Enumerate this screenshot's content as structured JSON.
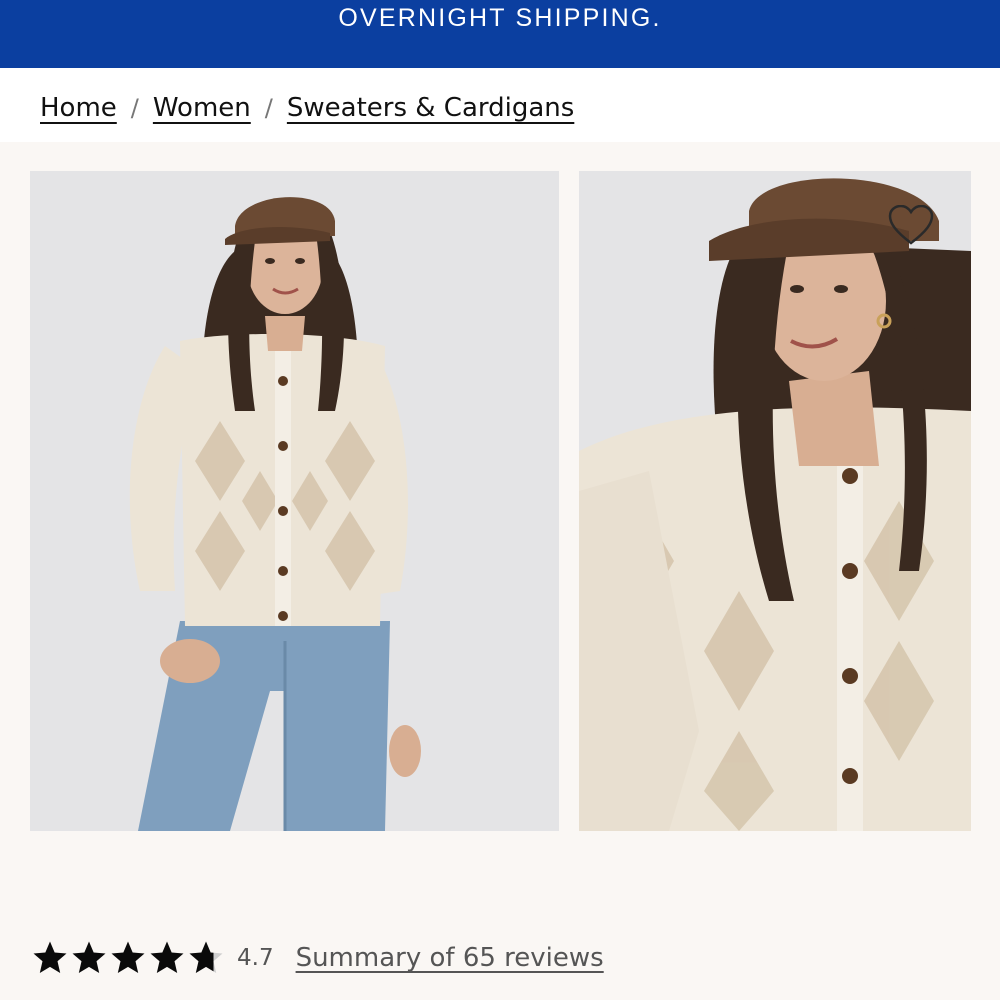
{
  "promo_banner": {
    "text": "OVERNIGHT SHIPPING."
  },
  "breadcrumb": {
    "items": [
      "Home",
      "Women",
      "Sweaters & Cardigans"
    ],
    "separator": "/"
  },
  "gallery": {
    "images": [
      {
        "description_icon": "model-full-photo"
      },
      {
        "description_icon": "model-closeup-photo"
      }
    ],
    "favorite_icon": "heart-outline-icon"
  },
  "rating": {
    "stars": 5,
    "value": "4.7",
    "reviews_link": "Summary of 65 reviews"
  },
  "colors": {
    "banner": "#0b3fa0",
    "gallery_bg": "#faf7f4",
    "cap": "#6b4a33",
    "sweater": "#ece4d6",
    "denim": "#7f9fbe"
  }
}
